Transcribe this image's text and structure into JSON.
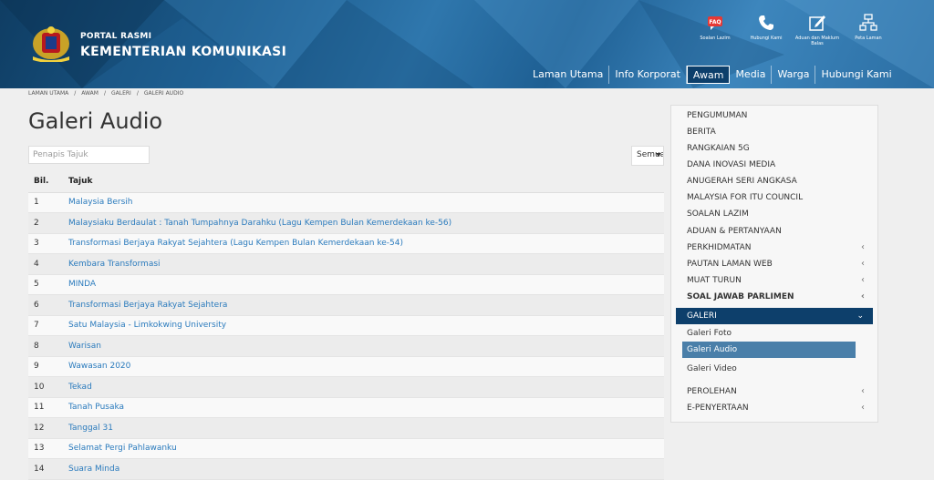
{
  "header": {
    "portal_small": "PORTAL RASMI",
    "portal_big": "KEMENTERIAN KOMUNIKASI",
    "top_icons": [
      {
        "icon": "faq-icon",
        "label": "Soalan Lazim"
      },
      {
        "icon": "phone-icon",
        "label": "Hubungi Kami"
      },
      {
        "icon": "complaint-icon",
        "label": "Aduan dan Maklum Balas"
      },
      {
        "icon": "sitemap-icon",
        "label": "Peta Laman"
      }
    ],
    "nav": [
      "Laman Utama",
      "Info Korporat",
      "Awam",
      "Media",
      "Warga",
      "Hubungi Kami"
    ],
    "nav_active": "Awam"
  },
  "breadcrumb": [
    "LAMAN UTAMA",
    "/",
    "AWAM",
    "/",
    "GALERI",
    "/",
    "GALERI AUDIO"
  ],
  "page_title": "Galeri Audio",
  "filter": {
    "placeholder": "Penapis Tajuk",
    "value": ""
  },
  "select": {
    "value": "Semua"
  },
  "table": {
    "headers": [
      "Bil.",
      "Tajuk"
    ],
    "rows": [
      [
        "1",
        "Malaysia Bersih"
      ],
      [
        "2",
        "Malaysiaku Berdaulat : Tanah Tumpahnya Darahku (Lagu Kempen Bulan Kemerdekaan ke-56)"
      ],
      [
        "3",
        "Transformasi Berjaya Rakyat Sejahtera (Lagu Kempen Bulan Kemerdekaan ke-54)"
      ],
      [
        "4",
        "Kembara Transformasi"
      ],
      [
        "5",
        "MINDA"
      ],
      [
        "6",
        "Transformasi Berjaya Rakyat Sejahtera"
      ],
      [
        "7",
        "Satu Malaysia - Limkokwing University"
      ],
      [
        "8",
        "Warisan"
      ],
      [
        "9",
        "Wawasan 2020"
      ],
      [
        "10",
        "Tekad"
      ],
      [
        "11",
        "Tanah Pusaka"
      ],
      [
        "12",
        "Tanggal 31"
      ],
      [
        "13",
        "Selamat Pergi Pahlawanku"
      ],
      [
        "14",
        "Suara Minda"
      ]
    ]
  },
  "sidebar": {
    "items": [
      {
        "label": "PENGUMUMAN",
        "chev": ""
      },
      {
        "label": "BERITA",
        "chev": ""
      },
      {
        "label": "RANGKAIAN 5G",
        "chev": ""
      },
      {
        "label": "DANA INOVASI MEDIA",
        "chev": ""
      },
      {
        "label": "ANUGERAH SERI ANGKASA",
        "chev": ""
      },
      {
        "label": "MALAYSIA FOR ITU COUNCIL",
        "chev": ""
      },
      {
        "label": "SOALAN LAZIM",
        "chev": ""
      },
      {
        "label": "ADUAN & PERTANYAAN",
        "chev": ""
      },
      {
        "label": "PERKHIDMATAN",
        "chev": "‹"
      },
      {
        "label": "PAUTAN LAMAN WEB",
        "chev": "‹"
      },
      {
        "label": "MUAT TURUN",
        "chev": "‹"
      },
      {
        "label": "SOAL JAWAB PARLIMEN",
        "chev": "‹"
      }
    ],
    "galeri": {
      "label": "GALERI",
      "chev": "⌄"
    },
    "galeri_sub": [
      "Galeri Foto",
      "Galeri Audio",
      "Galeri Video"
    ],
    "galeri_sub_active": "Galeri Audio",
    "bottom_items": [
      {
        "label": "PEROLEHAN",
        "chev": "‹"
      },
      {
        "label": "E-PENYERTAAN",
        "chev": "‹"
      }
    ]
  },
  "colors": {
    "nav_active_bg": "#0d3f6b",
    "link": "#2b7bbd",
    "sub_active": "#4a7fa9"
  }
}
